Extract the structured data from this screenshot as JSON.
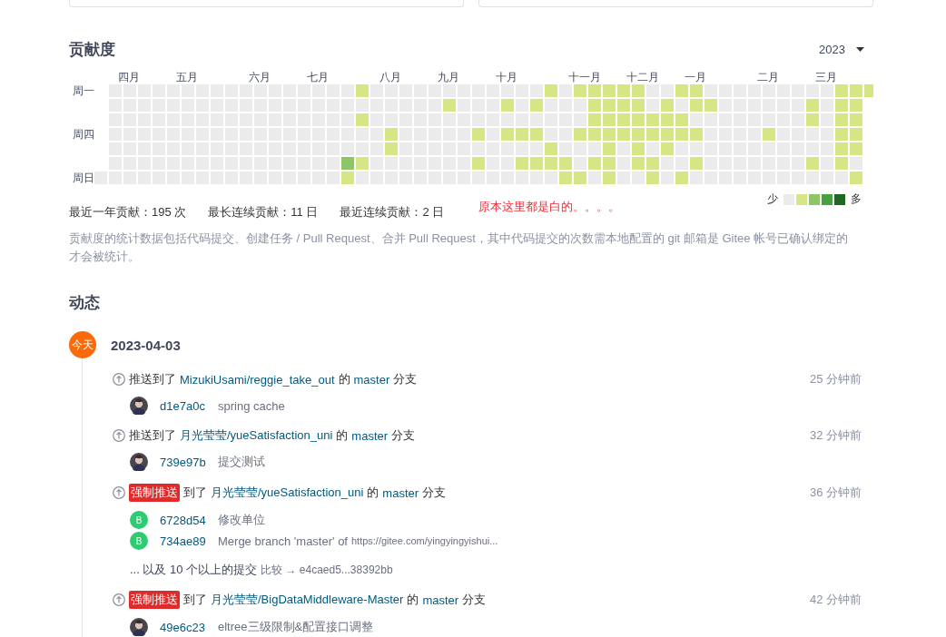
{
  "top_cards": [
    {
      "kind": "panel"
    },
    {
      "kind": "panel"
    }
  ],
  "contribution": {
    "title": "贡献度",
    "year": "2023",
    "weekdays": [
      "周一",
      "周四",
      "周日"
    ],
    "weeks": [
      {
        "days": [
          {
            "color": "#ebebeb"
          }
        ]
      },
      {
        "days": [
          {
            "color": "#ebebeb"
          },
          {
            "color": "#ebebeb"
          },
          {
            "color": "#ebebeb"
          },
          {
            "color": "#ebebeb"
          },
          {
            "color": "#ebebeb"
          },
          {
            "color": "#ebebeb"
          },
          {
            "color": "#ebebeb"
          }
        ],
        "month": "四月"
      },
      {
        "days": [
          {
            "color": "#ebebeb"
          },
          {
            "color": "#ebebeb"
          },
          {
            "color": "#ebebeb"
          },
          {
            "color": "#ebebeb"
          },
          {
            "color": "#ebebeb"
          },
          {
            "color": "#ebebeb"
          },
          {
            "color": "#ebebeb"
          }
        ]
      },
      {
        "days": [
          {
            "color": "#ebebeb"
          },
          {
            "color": "#ebebeb"
          },
          {
            "color": "#ebebeb"
          },
          {
            "color": "#ebebeb"
          },
          {
            "color": "#ebebeb"
          },
          {
            "color": "#ebebeb"
          },
          {
            "color": "#ebebeb"
          }
        ]
      },
      {
        "days": [
          {
            "color": "#ebebeb"
          },
          {
            "color": "#ebebeb"
          },
          {
            "color": "#ebebeb"
          },
          {
            "color": "#ebebeb"
          },
          {
            "color": "#ebebeb"
          },
          {
            "color": "#ebebeb"
          },
          {
            "color": "#ebebeb"
          }
        ]
      },
      {
        "days": [
          {
            "color": "#ebebeb"
          },
          {
            "color": "#ebebeb"
          },
          {
            "color": "#ebebeb"
          },
          {
            "color": "#ebebeb"
          },
          {
            "color": "#ebebeb"
          },
          {
            "color": "#ebebeb"
          },
          {
            "color": "#ebebeb"
          }
        ],
        "month": "五月"
      },
      {
        "days": [
          {
            "color": "#ebebeb"
          },
          {
            "color": "#ebebeb"
          },
          {
            "color": "#ebebeb"
          },
          {
            "color": "#ebebeb"
          },
          {
            "color": "#ebebeb"
          },
          {
            "color": "#ebebeb"
          },
          {
            "color": "#ebebeb"
          }
        ]
      },
      {
        "days": [
          {
            "color": "#ebebeb"
          },
          {
            "color": "#ebebeb"
          },
          {
            "color": "#ebebeb"
          },
          {
            "color": "#ebebeb"
          },
          {
            "color": "#ebebeb"
          },
          {
            "color": "#ebebeb"
          },
          {
            "color": "#ebebeb"
          }
        ]
      },
      {
        "days": [
          {
            "color": "#ebebeb"
          },
          {
            "color": "#ebebeb"
          },
          {
            "color": "#ebebeb"
          },
          {
            "color": "#ebebeb"
          },
          {
            "color": "#ebebeb"
          },
          {
            "color": "#ebebeb"
          },
          {
            "color": "#ebebeb"
          }
        ]
      },
      {
        "days": [
          {
            "color": "#ebebeb"
          },
          {
            "color": "#ebebeb"
          },
          {
            "color": "#ebebeb"
          },
          {
            "color": "#ebebeb"
          },
          {
            "color": "#ebebeb"
          },
          {
            "color": "#ebebeb"
          },
          {
            "color": "#ebebeb"
          }
        ]
      },
      {
        "days": [
          {
            "color": "#ebebeb"
          },
          {
            "color": "#ebebeb"
          },
          {
            "color": "#ebebeb"
          },
          {
            "color": "#ebebeb"
          },
          {
            "color": "#ebebeb"
          },
          {
            "color": "#ebebeb"
          },
          {
            "color": "#ebebeb"
          }
        ],
        "month": "六月"
      },
      {
        "days": [
          {
            "color": "#ebebeb"
          },
          {
            "color": "#ebebeb"
          },
          {
            "color": "#ebebeb"
          },
          {
            "color": "#ebebeb"
          },
          {
            "color": "#ebebeb"
          },
          {
            "color": "#ebebeb"
          },
          {
            "color": "#ebebeb"
          }
        ]
      },
      {
        "days": [
          {
            "color": "#ebebeb"
          },
          {
            "color": "#ebebeb"
          },
          {
            "color": "#ebebeb"
          },
          {
            "color": "#ebebeb"
          },
          {
            "color": "#ebebeb"
          },
          {
            "color": "#ebebeb"
          },
          {
            "color": "#ebebeb"
          }
        ]
      },
      {
        "days": [
          {
            "color": "#ebebeb"
          },
          {
            "color": "#ebebeb"
          },
          {
            "color": "#ebebeb"
          },
          {
            "color": "#ebebeb"
          },
          {
            "color": "#ebebeb"
          },
          {
            "color": "#ebebeb"
          },
          {
            "color": "#ebebeb"
          }
        ]
      },
      {
        "days": [
          {
            "color": "#ebebeb"
          },
          {
            "color": "#ebebeb"
          },
          {
            "color": "#ebebeb"
          },
          {
            "color": "#ebebeb"
          },
          {
            "color": "#ebebeb"
          },
          {
            "color": "#ebebeb"
          },
          {
            "color": "#ebebeb"
          }
        ],
        "month": "七月"
      },
      {
        "days": [
          {
            "color": "#ebebeb"
          },
          {
            "color": "#ebebeb"
          },
          {
            "color": "#ebebeb"
          },
          {
            "color": "#ebebeb"
          },
          {
            "color": "#ebebeb"
          },
          {
            "color": "#ebebeb"
          },
          {
            "color": "#ebebeb"
          }
        ]
      },
      {
        "days": [
          {
            "color": "#ebebeb"
          },
          {
            "color": "#ebebeb"
          },
          {
            "color": "#ebebeb"
          },
          {
            "color": "#ebebeb"
          },
          {
            "color": "#ebebeb"
          },
          {
            "color": "#ebebeb"
          },
          {
            "color": "#ebebeb"
          }
        ]
      },
      {
        "days": [
          {
            "color": "#ebebeb"
          },
          {
            "color": "#ebebeb"
          },
          {
            "color": "#ebebeb"
          },
          {
            "color": "#ebebeb"
          },
          {
            "color": "#ebebeb"
          },
          {
            "color": "#8cc665"
          },
          {
            "color": "#d6e685"
          }
        ]
      },
      {
        "days": [
          {
            "color": "#d6e685"
          },
          {
            "color": "#ebebeb"
          },
          {
            "color": "#d6e685"
          },
          {
            "color": "#ebebeb"
          },
          {
            "color": "#ebebeb"
          },
          {
            "color": "#d6e685"
          },
          {
            "color": "#ebebeb"
          }
        ]
      },
      {
        "days": [
          {
            "color": "#ebebeb"
          },
          {
            "color": "#ebebeb"
          },
          {
            "color": "#ebebeb"
          },
          {
            "color": "#ebebeb"
          },
          {
            "color": "#ebebeb"
          },
          {
            "color": "#ebebeb"
          },
          {
            "color": "#ebebeb"
          }
        ],
        "month": "八月"
      },
      {
        "days": [
          {
            "color": "#ebebeb"
          },
          {
            "color": "#ebebeb"
          },
          {
            "color": "#ebebeb"
          },
          {
            "color": "#d6e685"
          },
          {
            "color": "#d6e685"
          },
          {
            "color": "#ebebeb"
          },
          {
            "color": "#ebebeb"
          }
        ]
      },
      {
        "days": [
          {
            "color": "#ebebeb"
          },
          {
            "color": "#ebebeb"
          },
          {
            "color": "#ebebeb"
          },
          {
            "color": "#ebebeb"
          },
          {
            "color": "#ebebeb"
          },
          {
            "color": "#ebebeb"
          },
          {
            "color": "#ebebeb"
          }
        ]
      },
      {
        "days": [
          {
            "color": "#ebebeb"
          },
          {
            "color": "#ebebeb"
          },
          {
            "color": "#ebebeb"
          },
          {
            "color": "#ebebeb"
          },
          {
            "color": "#ebebeb"
          },
          {
            "color": "#ebebeb"
          },
          {
            "color": "#ebebeb"
          }
        ]
      },
      {
        "days": [
          {
            "color": "#ebebeb"
          },
          {
            "color": "#ebebeb"
          },
          {
            "color": "#ebebeb"
          },
          {
            "color": "#ebebeb"
          },
          {
            "color": "#ebebeb"
          },
          {
            "color": "#ebebeb"
          },
          {
            "color": "#ebebeb"
          }
        ],
        "month": "九月"
      },
      {
        "days": [
          {
            "color": "#ebebeb"
          },
          {
            "color": "#d6e685"
          },
          {
            "color": "#ebebeb"
          },
          {
            "color": "#ebebeb"
          },
          {
            "color": "#ebebeb"
          },
          {
            "color": "#ebebeb"
          },
          {
            "color": "#ebebeb"
          }
        ]
      },
      {
        "days": [
          {
            "color": "#ebebeb"
          },
          {
            "color": "#ebebeb"
          },
          {
            "color": "#ebebeb"
          },
          {
            "color": "#ebebeb"
          },
          {
            "color": "#ebebeb"
          },
          {
            "color": "#ebebeb"
          },
          {
            "color": "#ebebeb"
          }
        ]
      },
      {
        "days": [
          {
            "color": "#ebebeb"
          },
          {
            "color": "#ebebeb"
          },
          {
            "color": "#ebebeb"
          },
          {
            "color": "#d6e685"
          },
          {
            "color": "#ebebeb"
          },
          {
            "color": "#d6e685"
          },
          {
            "color": "#ebebeb"
          }
        ]
      },
      {
        "days": [
          {
            "color": "#ebebeb"
          },
          {
            "color": "#ebebeb"
          },
          {
            "color": "#ebebeb"
          },
          {
            "color": "#ebebeb"
          },
          {
            "color": "#ebebeb"
          },
          {
            "color": "#ebebeb"
          },
          {
            "color": "#ebebeb"
          }
        ],
        "month": "十月"
      },
      {
        "days": [
          {
            "color": "#ebebeb"
          },
          {
            "color": "#d6e685"
          },
          {
            "color": "#ebebeb"
          },
          {
            "color": "#d6e685"
          },
          {
            "color": "#ebebeb"
          },
          {
            "color": "#ebebeb"
          },
          {
            "color": "#ebebeb"
          }
        ]
      },
      {
        "days": [
          {
            "color": "#ebebeb"
          },
          {
            "color": "#ebebeb"
          },
          {
            "color": "#ebebeb"
          },
          {
            "color": "#d6e685"
          },
          {
            "color": "#ebebeb"
          },
          {
            "color": "#d6e685"
          },
          {
            "color": "#ebebeb"
          }
        ]
      },
      {
        "days": [
          {
            "color": "#ebebeb"
          },
          {
            "color": "#d6e685"
          },
          {
            "color": "#ebebeb"
          },
          {
            "color": "#d6e685"
          },
          {
            "color": "#ebebeb"
          },
          {
            "color": "#d6e685"
          },
          {
            "color": "#ebebeb"
          }
        ]
      },
      {
        "days": [
          {
            "color": "#d6e685"
          },
          {
            "color": "#ebebeb"
          },
          {
            "color": "#ebebeb"
          },
          {
            "color": "#ebebeb"
          },
          {
            "color": "#d6e685"
          },
          {
            "color": "#d6e685"
          },
          {
            "color": "#ebebeb"
          }
        ]
      },
      {
        "days": [
          {
            "color": "#ebebeb"
          },
          {
            "color": "#ebebeb"
          },
          {
            "color": "#ebebeb"
          },
          {
            "color": "#ebebeb"
          },
          {
            "color": "#ebebeb"
          },
          {
            "color": "#d6e685"
          },
          {
            "color": "#d6e685"
          }
        ],
        "month": "十一月"
      },
      {
        "days": [
          {
            "color": "#d6e685"
          },
          {
            "color": "#ebebeb"
          },
          {
            "color": "#ebebeb"
          },
          {
            "color": "#d6e685"
          },
          {
            "color": "#ebebeb"
          },
          {
            "color": "#ebebeb"
          },
          {
            "color": "#d6e685"
          }
        ]
      },
      {
        "days": [
          {
            "color": "#d6e685"
          },
          {
            "color": "#d6e685"
          },
          {
            "color": "#d6e685"
          },
          {
            "color": "#d6e685"
          },
          {
            "color": "#ebebeb"
          },
          {
            "color": "#d6e685"
          },
          {
            "color": "#ebebeb"
          }
        ]
      },
      {
        "days": [
          {
            "color": "#d6e685"
          },
          {
            "color": "#d6e685"
          },
          {
            "color": "#d6e685"
          },
          {
            "color": "#d6e685"
          },
          {
            "color": "#d6e685"
          },
          {
            "color": "#d6e685"
          },
          {
            "color": "#d6e685"
          }
        ]
      },
      {
        "days": [
          {
            "color": "#d6e685"
          },
          {
            "color": "#d6e685"
          },
          {
            "color": "#d6e685"
          },
          {
            "color": "#d6e685"
          },
          {
            "color": "#ebebeb"
          },
          {
            "color": "#ebebeb"
          },
          {
            "color": "#ebebeb"
          }
        ],
        "month": "十二月"
      },
      {
        "days": [
          {
            "color": "#d6e685"
          },
          {
            "color": "#d6e685"
          },
          {
            "color": "#d6e685"
          },
          {
            "color": "#d6e685"
          },
          {
            "color": "#d6e685"
          },
          {
            "color": "#d6e685"
          },
          {
            "color": "#ebebeb"
          }
        ]
      },
      {
        "days": [
          {
            "color": "#ebebeb"
          },
          {
            "color": "#ebebeb"
          },
          {
            "color": "#d6e685"
          },
          {
            "color": "#d6e685"
          },
          {
            "color": "#ebebeb"
          },
          {
            "color": "#d6e685"
          },
          {
            "color": "#d6e685"
          }
        ]
      },
      {
        "days": [
          {
            "color": "#ebebeb"
          },
          {
            "color": "#d6e685"
          },
          {
            "color": "#d6e685"
          },
          {
            "color": "#d6e685"
          },
          {
            "color": "#d6e685"
          },
          {
            "color": "#ebebeb"
          },
          {
            "color": "#ebebeb"
          }
        ]
      },
      {
        "days": [
          {
            "color": "#d6e685"
          },
          {
            "color": "#ebebeb"
          },
          {
            "color": "#d6e685"
          },
          {
            "color": "#d6e685"
          },
          {
            "color": "#ebebeb"
          },
          {
            "color": "#ebebeb"
          },
          {
            "color": "#d6e685"
          }
        ],
        "month": "一月"
      },
      {
        "days": [
          {
            "color": "#d6e685"
          },
          {
            "color": "#d6e685"
          },
          {
            "color": "#ebebeb"
          },
          {
            "color": "#d6e685"
          },
          {
            "color": "#ebebeb"
          },
          {
            "color": "#d6e685"
          },
          {
            "color": "#ebebeb"
          }
        ]
      },
      {
        "days": [
          {
            "color": "#ebebeb"
          },
          {
            "color": "#d6e685"
          },
          {
            "color": "#ebebeb"
          },
          {
            "color": "#ebebeb"
          },
          {
            "color": "#ebebeb"
          },
          {
            "color": "#ebebeb"
          },
          {
            "color": "#ebebeb"
          }
        ]
      },
      {
        "days": [
          {
            "color": "#ebebeb"
          },
          {
            "color": "#ebebeb"
          },
          {
            "color": "#ebebeb"
          },
          {
            "color": "#ebebeb"
          },
          {
            "color": "#ebebeb"
          },
          {
            "color": "#ebebeb"
          },
          {
            "color": "#ebebeb"
          }
        ]
      },
      {
        "days": [
          {
            "color": "#ebebeb"
          },
          {
            "color": "#ebebeb"
          },
          {
            "color": "#ebebeb"
          },
          {
            "color": "#ebebeb"
          },
          {
            "color": "#ebebeb"
          },
          {
            "color": "#ebebeb"
          },
          {
            "color": "#ebebeb"
          }
        ]
      },
      {
        "days": [
          {
            "color": "#ebebeb"
          },
          {
            "color": "#ebebeb"
          },
          {
            "color": "#ebebeb"
          },
          {
            "color": "#ebebeb"
          },
          {
            "color": "#ebebeb"
          },
          {
            "color": "#ebebeb"
          },
          {
            "color": "#ebebeb"
          }
        ],
        "month": "二月"
      },
      {
        "days": [
          {
            "color": "#ebebeb"
          },
          {
            "color": "#ebebeb"
          },
          {
            "color": "#ebebeb"
          },
          {
            "color": "#d6e685"
          },
          {
            "color": "#ebebeb"
          },
          {
            "color": "#ebebeb"
          },
          {
            "color": "#ebebeb"
          }
        ]
      },
      {
        "days": [
          {
            "color": "#ebebeb"
          },
          {
            "color": "#ebebeb"
          },
          {
            "color": "#ebebeb"
          },
          {
            "color": "#ebebeb"
          },
          {
            "color": "#ebebeb"
          },
          {
            "color": "#ebebeb"
          },
          {
            "color": "#ebebeb"
          }
        ]
      },
      {
        "days": [
          {
            "color": "#ebebeb"
          },
          {
            "color": "#ebebeb"
          },
          {
            "color": "#ebebeb"
          },
          {
            "color": "#ebebeb"
          },
          {
            "color": "#ebebeb"
          },
          {
            "color": "#ebebeb"
          },
          {
            "color": "#ebebeb"
          }
        ]
      },
      {
        "days": [
          {
            "color": "#ebebeb"
          },
          {
            "color": "#d6e685"
          },
          {
            "color": "#d6e685"
          },
          {
            "color": "#ebebeb"
          },
          {
            "color": "#ebebeb"
          },
          {
            "color": "#d6e685"
          },
          {
            "color": "#ebebeb"
          }
        ],
        "month": "三月"
      },
      {
        "days": [
          {
            "color": "#ebebeb"
          },
          {
            "color": "#ebebeb"
          },
          {
            "color": "#ebebeb"
          },
          {
            "color": "#ebebeb"
          },
          {
            "color": "#ebebeb"
          },
          {
            "color": "#ebebeb"
          },
          {
            "color": "#ebebeb"
          }
        ]
      },
      {
        "days": [
          {
            "color": "#d6e685"
          },
          {
            "color": "#d6e685"
          },
          {
            "color": "#d6e685"
          },
          {
            "color": "#d6e685"
          },
          {
            "color": "#d6e685"
          },
          {
            "color": "#d6e685"
          },
          {
            "color": "#ebebeb"
          }
        ]
      },
      {
        "days": [
          {
            "color": "#d6e685"
          },
          {
            "color": "#d6e685"
          },
          {
            "color": "#d6e685"
          },
          {
            "color": "#d6e685"
          },
          {
            "color": "#d6e685"
          },
          {
            "color": "#ebebeb"
          },
          {
            "color": "#d6e685"
          }
        ]
      },
      {
        "days": [
          {
            "color": "#d6e685"
          }
        ]
      }
    ],
    "legend": {
      "less": "少",
      "more": "多",
      "levels": [
        {
          "color": "#ebebeb"
        },
        {
          "color": "#d6e685"
        },
        {
          "color": "#8cc665"
        },
        {
          "color": "#44a340"
        },
        {
          "color": "#1e6823"
        }
      ]
    },
    "stats": [
      "最近一年贡献：195 次",
      "最长连续贡献：11 日",
      "最近连续贡献：2 日"
    ],
    "note": "原本这里都是白的。。。。",
    "description": "贡献度的统计数据包括代码提交、创建任务 / Pull Request、合并 Pull Request，其中代码提交的次数需本地配置的 git 邮箱是 Gitee 帐号已确认绑定的才会被统计。"
  },
  "activity": {
    "title": "动态",
    "day_badge": "今天",
    "date": "2023-04-03",
    "events": [
      {
        "action": "推送到了",
        "repo": "MizukiUsami/reggie_take_out",
        "of": "的",
        "branch": "master",
        "suffix": "分支",
        "time": "25 分钟前",
        "commits": [
          {
            "kind": "photo",
            "hash": "d1e7a0c",
            "message": "spring cache"
          }
        ]
      },
      {
        "action": "推送到了",
        "repo": "月光莹莹/yueSatisfaction_uni",
        "of": "的",
        "branch": "master",
        "suffix": "分支",
        "time": "32 分钟前",
        "commits": [
          {
            "kind": "photo",
            "hash": "739e97b",
            "message": "提交测试"
          }
        ]
      },
      {
        "badge": "强制推送",
        "action": "到了",
        "repo": "月光莹莹/yueSatisfaction_uni",
        "of": "的",
        "branch": "master",
        "suffix": "分支",
        "time": "36 分钟前",
        "commits": [
          {
            "kind": "letter",
            "letter": "B",
            "hash": "6728d54",
            "message": "修改单位"
          },
          {
            "kind": "letter",
            "letter": "B",
            "hash": "734ae89",
            "message": "Merge branch 'master' of",
            "url": "https://gitee.com/yingyingyishui..."
          }
        ],
        "more": {
          "text": "... 以及 10 个以上的提交",
          "compare": "比较 → e4caed5...38392bb"
        }
      },
      {
        "badge": "强制推送",
        "action": "到了",
        "repo": "月光莹莹/BigDataMiddleware-Master",
        "of": "的",
        "branch": "master",
        "suffix": "分支",
        "time": "42 分钟前",
        "commits": [
          {
            "kind": "photo",
            "hash": "49e6c23",
            "message": "eltree三级限制&配置接口调整"
          }
        ]
      }
    ]
  }
}
